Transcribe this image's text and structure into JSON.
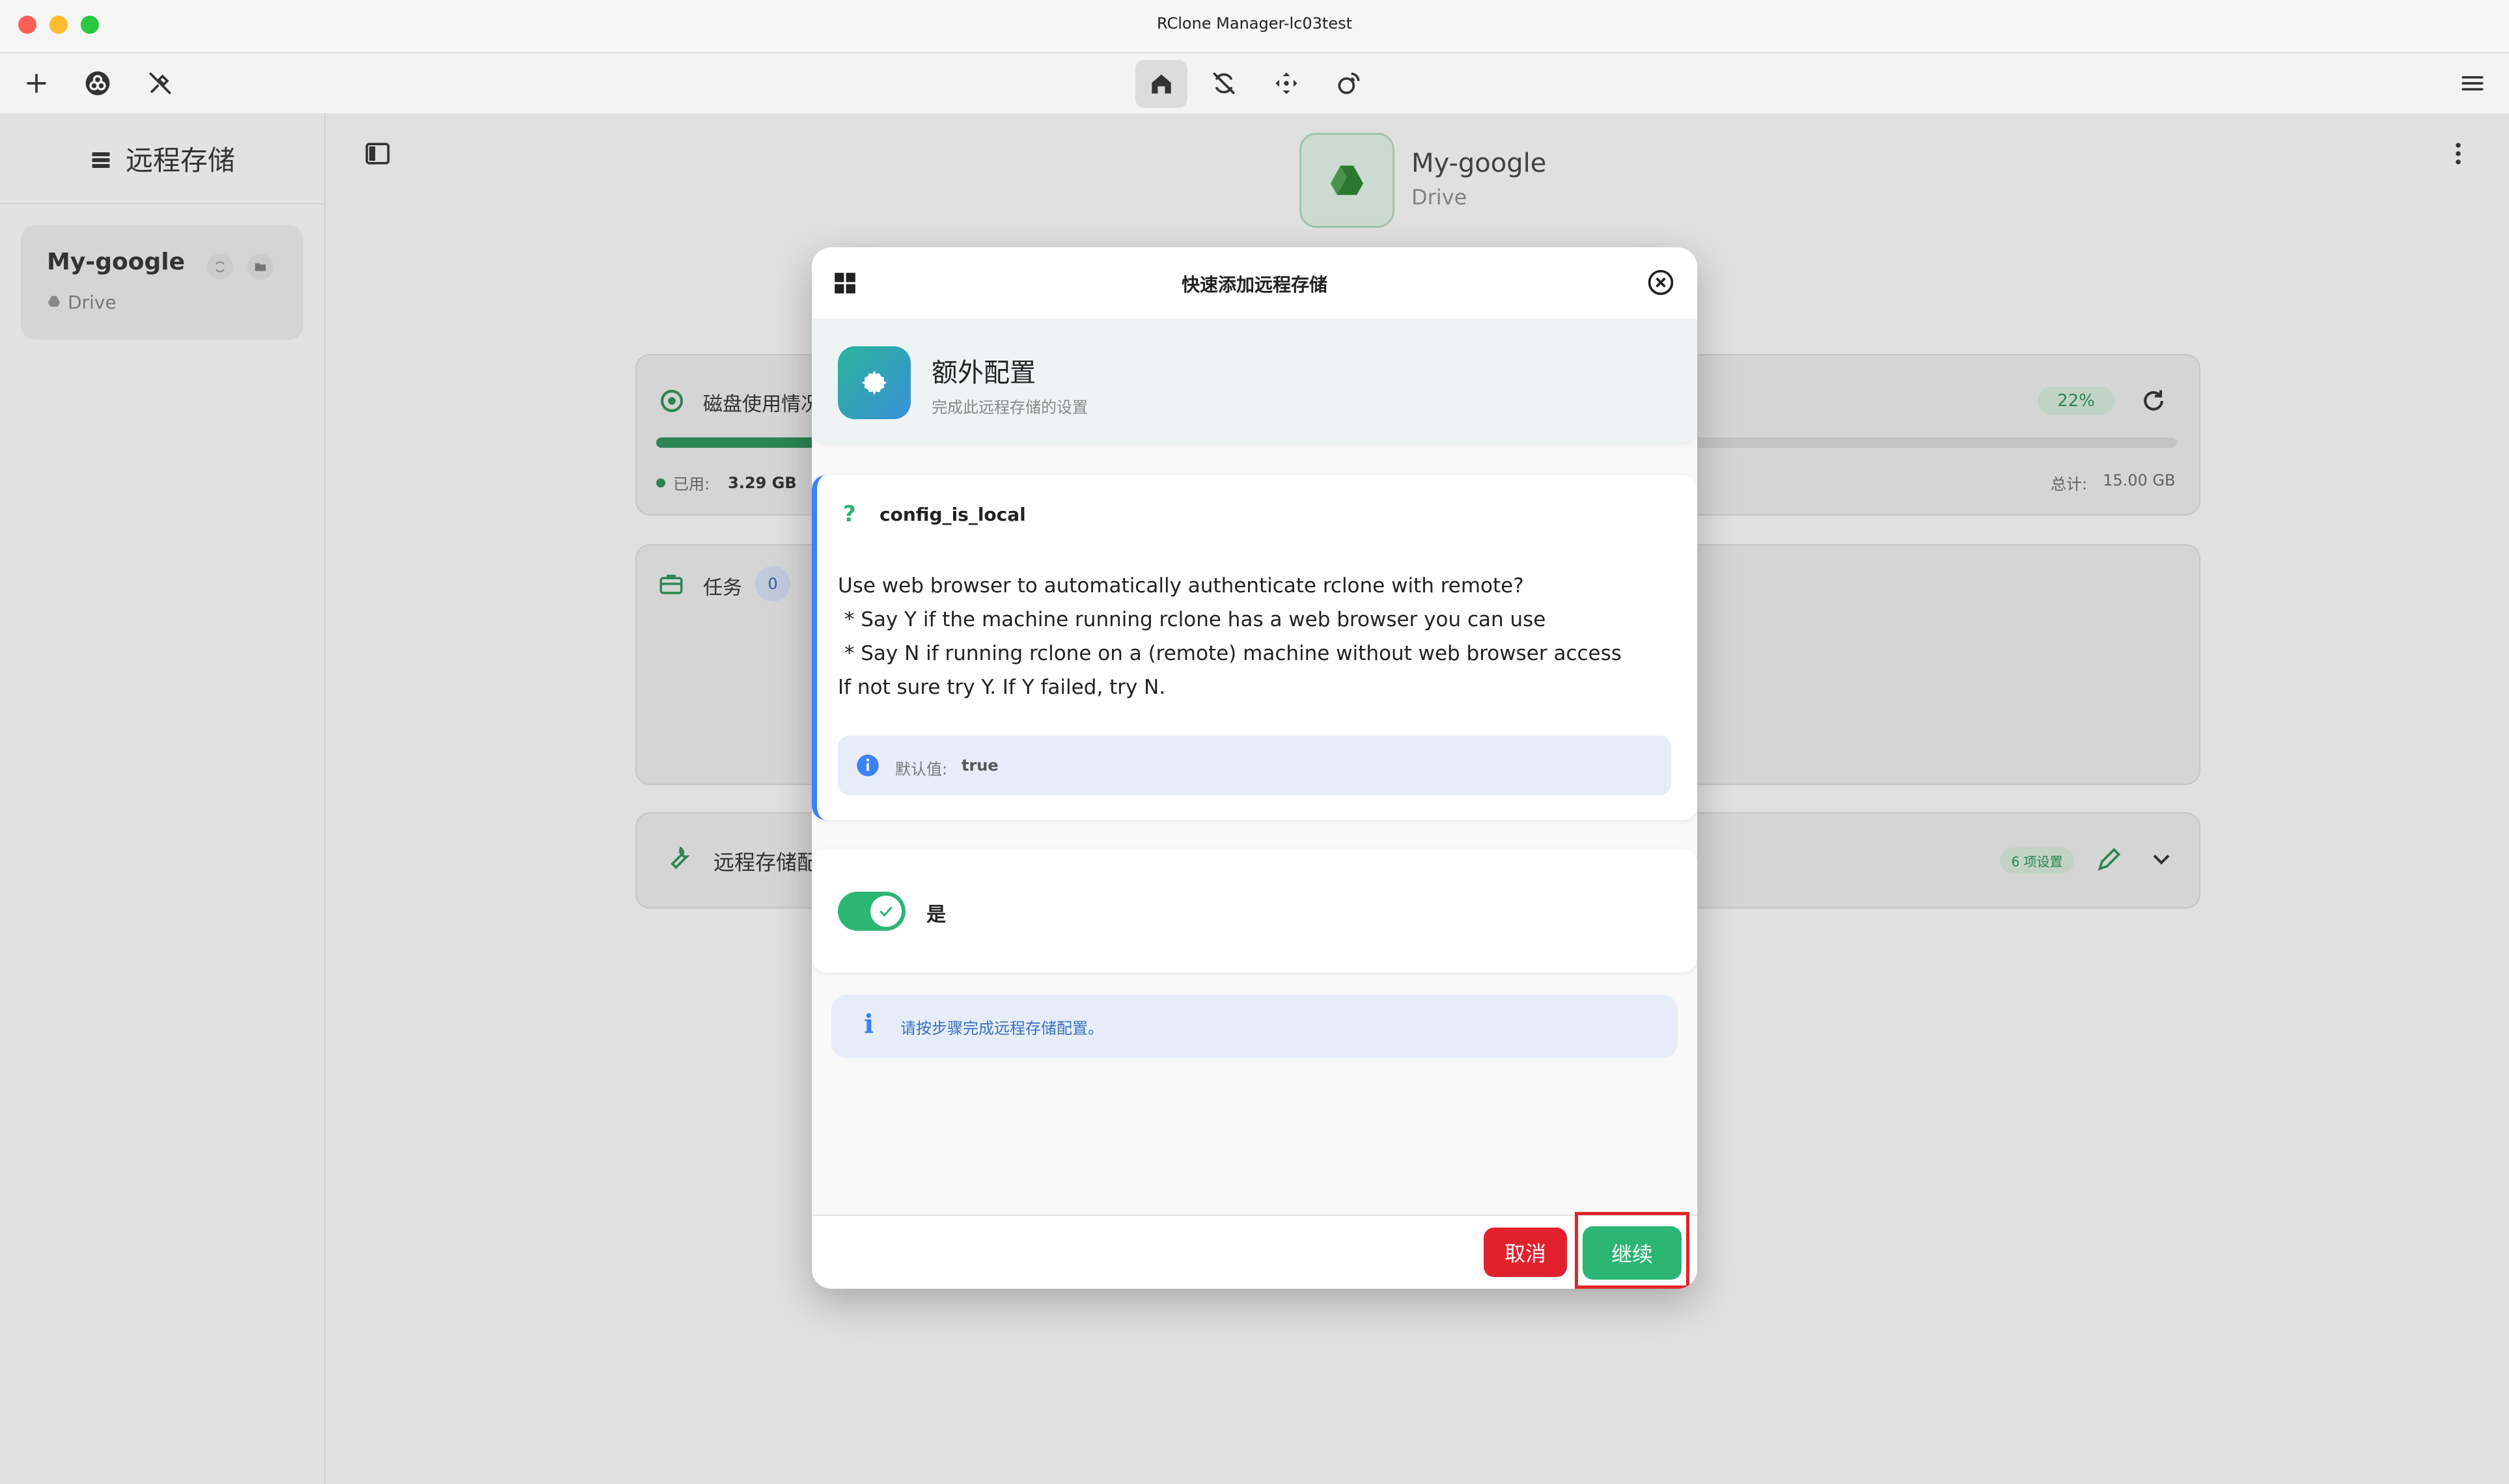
{
  "window": {
    "title": "RClone Manager-lc03test",
    "traffic_colors": [
      "#fe5f57",
      "#febc2e",
      "#28c840"
    ]
  },
  "toolbar": {
    "left_icons": [
      "plus-icon",
      "rclone-logo-icon",
      "tools-off-icon"
    ],
    "center_icons": [
      "home-icon",
      "sync-icon",
      "move-icon",
      "mount-icon"
    ],
    "right_icons": [
      "hamburger-menu-icon"
    ]
  },
  "sidebar": {
    "title": "远程存储",
    "remotes": [
      {
        "name": "My-google",
        "type": "Drive"
      }
    ]
  },
  "main": {
    "remote_name": "My-google",
    "remote_type": "Drive",
    "disk": {
      "title": "磁盘使用情况",
      "percent_label": "22%",
      "used_fraction": 0.22,
      "used_label": "已用:",
      "used_value": "3.29 GB",
      "total_label": "总计:",
      "total_value": "15.00 GB"
    },
    "tasks": {
      "title": "任务",
      "count": "0"
    },
    "config": {
      "title": "远程存储配",
      "badge": "6 项设置"
    }
  },
  "dialog": {
    "title": "快速添加远程存储",
    "step": {
      "title": "额外配置",
      "subtitle": "完成此远程存储的设置"
    },
    "question": {
      "name": "config_is_local",
      "lines": [
        "Use web browser to automatically authenticate rclone with remote?",
        " * Say Y if the machine running rclone has a web browser you can use",
        " * Say N if running rclone on a (remote) machine without web browser access",
        "If not sure try Y. If Y failed, try N."
      ],
      "default_label": "默认值:",
      "default_value": "true"
    },
    "toggle": {
      "label": "是",
      "checked": true
    },
    "info": "请按步骤完成远程存储配置。",
    "cancel_label": "取消",
    "continue_label": "继续"
  },
  "colors": {
    "accent_green": "#2bb673",
    "cancel_red": "#e3212d",
    "info_blue": "#3b82f6",
    "highlight_box": "#e0262b"
  }
}
